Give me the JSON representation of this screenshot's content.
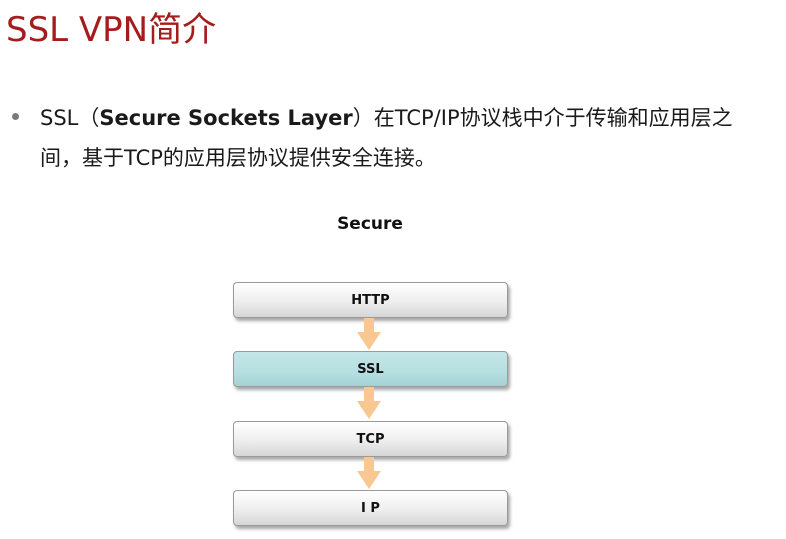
{
  "slide": {
    "title": "SSL VPN简介",
    "bullet": {
      "prefix": "SSL（",
      "bold": "Secure Sockets Layer",
      "suffix": "）在TCP/IP协议栈中介于传输和应用层之间，基于TCP的应用层协议提供安全连接。"
    }
  },
  "diagram": {
    "title": "Secure",
    "layers": [
      "HTTP",
      "SSL",
      "TCP",
      "I P"
    ],
    "colors": {
      "layer_default": "#eeeeee",
      "layer_highlight": "#b6dfe1",
      "arrow": "#f9c792"
    }
  }
}
